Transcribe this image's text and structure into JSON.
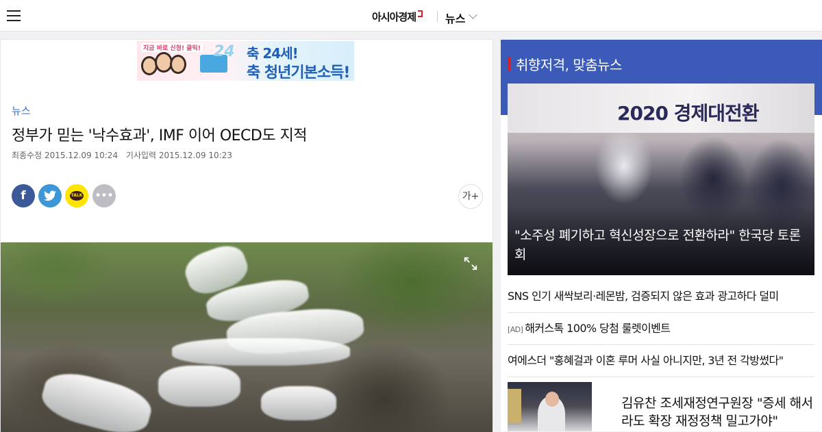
{
  "header": {
    "logo": "아시아경제",
    "section": "뉴스"
  },
  "article": {
    "ad": {
      "small_text": "지금 바로 신청! 클릭!",
      "number": "24",
      "line1": "축 24세!",
      "line2": "축 청년기본소득!"
    },
    "category": "뉴스",
    "headline": "정부가 믿는 '낙수효과', IMF 이어 OECD도 지적",
    "modified": "최종수정 2015.12.09 10:24",
    "published": "기사입력 2015.12.09 10:23",
    "share": {
      "facebook": "f",
      "kakao": "TALK",
      "more": "•••"
    },
    "font_size_button": "가+"
  },
  "sidebar": {
    "title": "취향저격, 맞춤뉴스",
    "feature": {
      "banner_text": "2020 경제대전환",
      "caption": "\"소주성 폐기하고 혁신성장으로 전환하라\" 한국당 토론회"
    },
    "news": [
      {
        "ad": "",
        "title": "SNS 인기 새싹보리·레몬밤, 검증되지 않은 효과 광고하다 덜미"
      },
      {
        "ad": "[AD]",
        "title": "해커스톡 100% 당첨 룰렛이벤트"
      },
      {
        "ad": "",
        "title": "여에스더 \"홍혜걸과 이혼 루머 사실 아니지만, 3년 전 각방썼다\""
      }
    ],
    "thumb_news": {
      "title": "김유찬 조세재정연구원장 \"증세 해서라도 확장 재정정책 밀고가야\""
    }
  },
  "colors": {
    "accent_blue": "#3c5ab7",
    "brand_red": "#d61f26",
    "category_blue": "#2a6fd1"
  }
}
